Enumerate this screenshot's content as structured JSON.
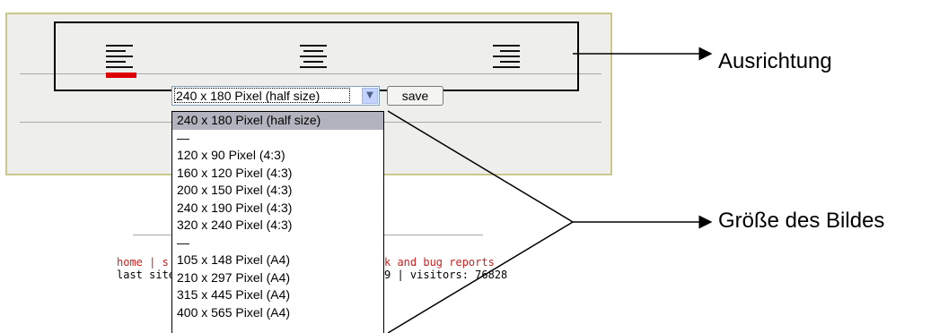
{
  "alignment": {
    "options": [
      "align-left",
      "align-center",
      "align-right"
    ],
    "selected": "align-left",
    "selected_color": "#dd0000"
  },
  "size_select": {
    "value": "240 x 180 Pixel (half size)",
    "arrow": "chevron-down-icon"
  },
  "save_label": "save",
  "dropdown": {
    "items": [
      "240 x 180 Pixel (half size)",
      "—",
      "120 x 90 Pixel (4:3)",
      "160 x 120 Pixel (4:3)",
      "200 x 150 Pixel (4:3)",
      "240 x 190 Pixel (4:3)",
      "320 x 240 Pixel (4:3)",
      "—",
      "105 x 148 Pixel (A4)",
      "210 x 297 Pixel (A4)",
      "315 x 445 Pixel (A4)",
      "400 x 565 Pixel (A4)"
    ],
    "selected_index": 0
  },
  "footer": {
    "link_home": "home",
    "sep": "|",
    "link_partial_left": "s",
    "link_partial_right": "k and bug reports",
    "line2_left": "last site",
    "line2_right": "9 | visitors: 76828",
    "link_color": "#cc2222"
  },
  "callouts": {
    "alignment": "Ausrichtung",
    "size": "Größe des Bildes"
  }
}
